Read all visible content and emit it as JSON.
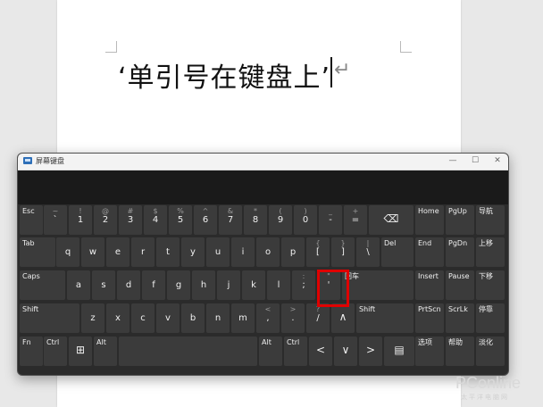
{
  "document": {
    "text": "‘单引号在键盘上’",
    "paragraph_mark": "↵"
  },
  "osk": {
    "title": "屏幕键盘",
    "controls": {
      "minimize": "—",
      "maximize": "☐",
      "close": "✕"
    },
    "rows": [
      [
        {
          "id": "esc",
          "label": "Esc"
        },
        {
          "id": "backtick",
          "top": "~",
          "main": "`"
        },
        {
          "id": "1",
          "top": "!",
          "main": "1"
        },
        {
          "id": "2",
          "top": "@",
          "main": "2"
        },
        {
          "id": "3",
          "top": "#",
          "main": "3"
        },
        {
          "id": "4",
          "top": "$",
          "main": "4"
        },
        {
          "id": "5",
          "top": "%",
          "main": "5"
        },
        {
          "id": "6",
          "top": "^",
          "main": "6"
        },
        {
          "id": "7",
          "top": "&",
          "main": "7"
        },
        {
          "id": "8",
          "top": "*",
          "main": "8"
        },
        {
          "id": "9",
          "top": "(",
          "main": "9"
        },
        {
          "id": "0",
          "top": ")",
          "main": "0"
        },
        {
          "id": "minus",
          "top": "_",
          "main": "-"
        },
        {
          "id": "equals",
          "top": "+",
          "main": "="
        },
        {
          "id": "backspace",
          "glyph": "⌫"
        },
        {
          "id": "home",
          "label": "Home"
        },
        {
          "id": "pgup",
          "label": "PgUp"
        },
        {
          "id": "nav",
          "label": "导航"
        }
      ],
      [
        {
          "id": "tab",
          "label": "Tab"
        },
        {
          "id": "q",
          "main": "q"
        },
        {
          "id": "w",
          "main": "w"
        },
        {
          "id": "e",
          "main": "e"
        },
        {
          "id": "r",
          "main": "r"
        },
        {
          "id": "t",
          "main": "t"
        },
        {
          "id": "y",
          "main": "y"
        },
        {
          "id": "u",
          "main": "u"
        },
        {
          "id": "i",
          "main": "i"
        },
        {
          "id": "o",
          "main": "o"
        },
        {
          "id": "p",
          "main": "p"
        },
        {
          "id": "lbracket",
          "top": "{",
          "main": "["
        },
        {
          "id": "rbracket",
          "top": "}",
          "main": "]"
        },
        {
          "id": "backslash",
          "top": "|",
          "main": "\\"
        },
        {
          "id": "del",
          "label": "Del"
        },
        {
          "id": "end",
          "label": "End"
        },
        {
          "id": "pgdn",
          "label": "PgDn"
        },
        {
          "id": "moveup",
          "label": "上移"
        }
      ],
      [
        {
          "id": "caps",
          "label": "Caps"
        },
        {
          "id": "a",
          "main": "a"
        },
        {
          "id": "s",
          "main": "s"
        },
        {
          "id": "d",
          "main": "d"
        },
        {
          "id": "f",
          "main": "f"
        },
        {
          "id": "g",
          "main": "g"
        },
        {
          "id": "h",
          "main": "h"
        },
        {
          "id": "j",
          "main": "j"
        },
        {
          "id": "k",
          "main": "k"
        },
        {
          "id": "l",
          "main": "l"
        },
        {
          "id": "semicolon",
          "top": ":",
          "main": ";"
        },
        {
          "id": "quote",
          "top": "\"",
          "main": "'"
        },
        {
          "id": "enter",
          "label": "回车"
        },
        {
          "id": "insert",
          "label": "Insert"
        },
        {
          "id": "pause",
          "label": "Pause"
        },
        {
          "id": "movedown",
          "label": "下移"
        }
      ],
      [
        {
          "id": "lshift",
          "label": "Shift"
        },
        {
          "id": "z",
          "main": "z"
        },
        {
          "id": "x",
          "main": "x"
        },
        {
          "id": "c",
          "main": "c"
        },
        {
          "id": "v",
          "main": "v"
        },
        {
          "id": "b",
          "main": "b"
        },
        {
          "id": "n",
          "main": "n"
        },
        {
          "id": "m",
          "main": "m"
        },
        {
          "id": "comma",
          "top": "<",
          "main": ","
        },
        {
          "id": "period",
          "top": ">",
          "main": "."
        },
        {
          "id": "slash",
          "top": "?",
          "main": "/"
        },
        {
          "id": "uparrow",
          "glyph": "∧"
        },
        {
          "id": "rshift",
          "label": "Shift"
        },
        {
          "id": "prtscn",
          "label": "PrtScn"
        },
        {
          "id": "scrlk",
          "label": "ScrLk"
        },
        {
          "id": "dock",
          "label": "停靠"
        }
      ],
      [
        {
          "id": "fn",
          "label": "Fn"
        },
        {
          "id": "lctrl",
          "label": "Ctrl"
        },
        {
          "id": "win",
          "glyph": "⊞"
        },
        {
          "id": "lalt",
          "label": "Alt"
        },
        {
          "id": "space",
          "main": ""
        },
        {
          "id": "ralt",
          "label": "Alt"
        },
        {
          "id": "rctrl",
          "label": "Ctrl"
        },
        {
          "id": "leftarrow",
          "glyph": "<"
        },
        {
          "id": "downarrow",
          "glyph": "∨"
        },
        {
          "id": "rightarrow",
          "glyph": ">"
        },
        {
          "id": "menu",
          "glyph": "▤"
        },
        {
          "id": "options",
          "label": "选项"
        },
        {
          "id": "help",
          "label": "帮助"
        },
        {
          "id": "fade",
          "label": "淡化"
        }
      ]
    ]
  },
  "watermark": {
    "brand": "PConline",
    "sub": "太平洋电脑网"
  }
}
